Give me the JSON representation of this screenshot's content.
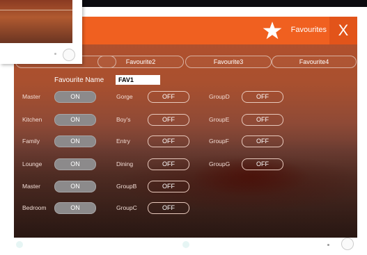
{
  "header": {
    "title": "Favourites",
    "close_label": "X"
  },
  "tabs": [
    "",
    "Favourite2",
    "Favourite3",
    "Favourite4"
  ],
  "favourite_name": {
    "label": "Favourite Name",
    "value": "FAV1"
  },
  "col1": [
    {
      "label": "Master",
      "state": "ON"
    },
    {
      "label": "Kitchen",
      "state": "ON"
    },
    {
      "label": "Family",
      "state": "ON"
    },
    {
      "label": "Lounge",
      "state": "ON"
    },
    {
      "label": "Master",
      "state": "ON"
    },
    {
      "label": "Bedroom",
      "state": "ON"
    }
  ],
  "col2": [
    {
      "label": "Gorge",
      "state": "OFF"
    },
    {
      "label": "Boy's",
      "state": "OFF"
    },
    {
      "label": "Entry",
      "state": "OFF"
    },
    {
      "label": "Dining",
      "state": "OFF"
    },
    {
      "label": "GroupB",
      "state": "OFF"
    },
    {
      "label": "GroupC",
      "state": "OFF"
    }
  ],
  "col3": [
    {
      "label": "GroupD",
      "state": "OFF"
    },
    {
      "label": "GroupE",
      "state": "OFF"
    },
    {
      "label": "GroupF",
      "state": "OFF"
    },
    {
      "label": "GroupG",
      "state": "OFF"
    }
  ],
  "colors": {
    "accent": "#f06020",
    "close_bg": "#e2541a",
    "toggle_on": "#8c8a8b"
  },
  "icons": {
    "star": "star-icon",
    "close": "close-icon",
    "avatar": "avatar-icon"
  }
}
